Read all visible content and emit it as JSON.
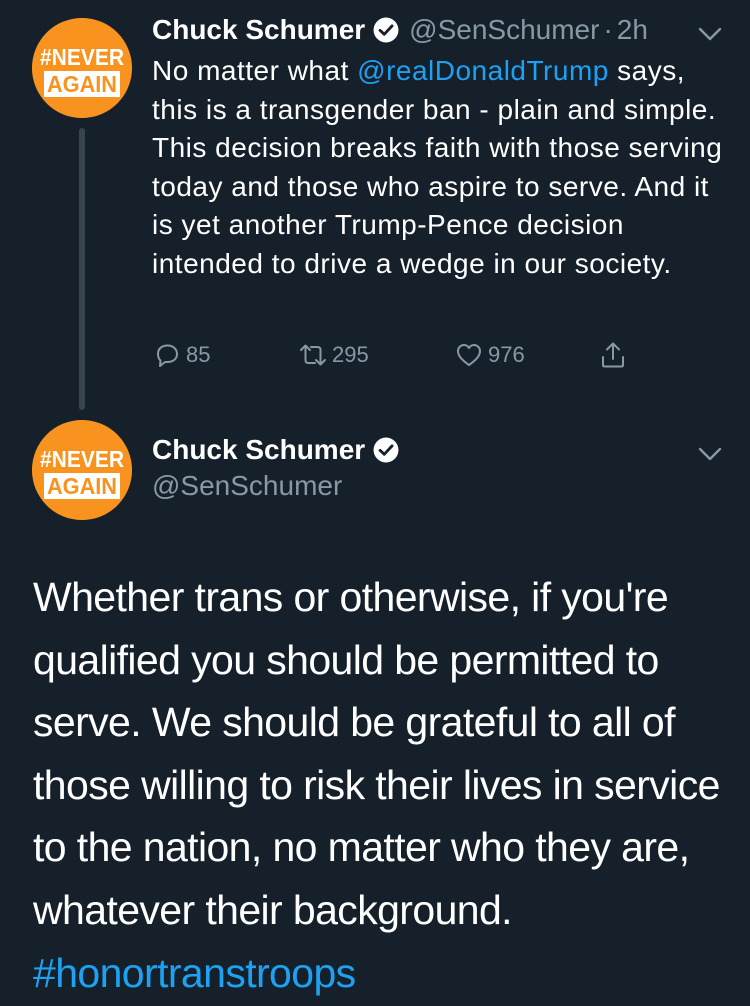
{
  "tweet1": {
    "author_name": "Chuck Schumer",
    "handle": "@SenSchumer",
    "separator": "·",
    "time": "2h",
    "text_before_mention": "No matter what ",
    "mention": "@realDonaldTrump",
    "text_after_mention": " says, this is a transgender ban - plain and simple. This decision breaks faith with those serving today and those who aspire to serve. And it is yet another Trump-Pence decision intended to drive a wedge in our society.",
    "actions": {
      "reply_count": "85",
      "retweet_count": "295",
      "like_count": "976"
    }
  },
  "tweet2": {
    "author_name": "Chuck Schumer",
    "handle": "@SenSchumer",
    "text": "Whether trans or otherwise, if you're qualified you should be permitted to serve. We should be grateful to all of those willing to risk their lives in service to the nation, no matter who they are, whatever their background.",
    "hashtag": "#honortranstroops"
  },
  "avatar": {
    "line1": "#NEVER",
    "line2": "AGAIN",
    "background_color": "#f7931e"
  },
  "colors": {
    "background": "#15202b",
    "link": "#1da1f2",
    "muted": "#8899a6"
  },
  "icons": {
    "verified": "verified-badge-icon",
    "menu": "chevron-down-icon",
    "reply": "reply-icon",
    "retweet": "retweet-icon",
    "like": "heart-icon",
    "share": "share-icon"
  }
}
